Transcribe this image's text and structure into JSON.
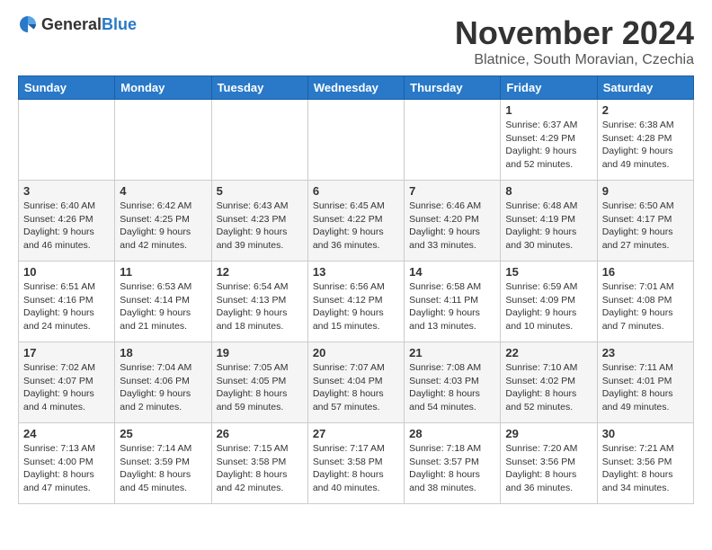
{
  "header": {
    "logo_general": "General",
    "logo_blue": "Blue",
    "month_title": "November 2024",
    "location": "Blatnice, South Moravian, Czechia"
  },
  "days_of_week": [
    "Sunday",
    "Monday",
    "Tuesday",
    "Wednesday",
    "Thursday",
    "Friday",
    "Saturday"
  ],
  "weeks": [
    [
      {
        "day": "",
        "info": ""
      },
      {
        "day": "",
        "info": ""
      },
      {
        "day": "",
        "info": ""
      },
      {
        "day": "",
        "info": ""
      },
      {
        "day": "",
        "info": ""
      },
      {
        "day": "1",
        "info": "Sunrise: 6:37 AM\nSunset: 4:29 PM\nDaylight: 9 hours\nand 52 minutes."
      },
      {
        "day": "2",
        "info": "Sunrise: 6:38 AM\nSunset: 4:28 PM\nDaylight: 9 hours\nand 49 minutes."
      }
    ],
    [
      {
        "day": "3",
        "info": "Sunrise: 6:40 AM\nSunset: 4:26 PM\nDaylight: 9 hours\nand 46 minutes."
      },
      {
        "day": "4",
        "info": "Sunrise: 6:42 AM\nSunset: 4:25 PM\nDaylight: 9 hours\nand 42 minutes."
      },
      {
        "day": "5",
        "info": "Sunrise: 6:43 AM\nSunset: 4:23 PM\nDaylight: 9 hours\nand 39 minutes."
      },
      {
        "day": "6",
        "info": "Sunrise: 6:45 AM\nSunset: 4:22 PM\nDaylight: 9 hours\nand 36 minutes."
      },
      {
        "day": "7",
        "info": "Sunrise: 6:46 AM\nSunset: 4:20 PM\nDaylight: 9 hours\nand 33 minutes."
      },
      {
        "day": "8",
        "info": "Sunrise: 6:48 AM\nSunset: 4:19 PM\nDaylight: 9 hours\nand 30 minutes."
      },
      {
        "day": "9",
        "info": "Sunrise: 6:50 AM\nSunset: 4:17 PM\nDaylight: 9 hours\nand 27 minutes."
      }
    ],
    [
      {
        "day": "10",
        "info": "Sunrise: 6:51 AM\nSunset: 4:16 PM\nDaylight: 9 hours\nand 24 minutes."
      },
      {
        "day": "11",
        "info": "Sunrise: 6:53 AM\nSunset: 4:14 PM\nDaylight: 9 hours\nand 21 minutes."
      },
      {
        "day": "12",
        "info": "Sunrise: 6:54 AM\nSunset: 4:13 PM\nDaylight: 9 hours\nand 18 minutes."
      },
      {
        "day": "13",
        "info": "Sunrise: 6:56 AM\nSunset: 4:12 PM\nDaylight: 9 hours\nand 15 minutes."
      },
      {
        "day": "14",
        "info": "Sunrise: 6:58 AM\nSunset: 4:11 PM\nDaylight: 9 hours\nand 13 minutes."
      },
      {
        "day": "15",
        "info": "Sunrise: 6:59 AM\nSunset: 4:09 PM\nDaylight: 9 hours\nand 10 minutes."
      },
      {
        "day": "16",
        "info": "Sunrise: 7:01 AM\nSunset: 4:08 PM\nDaylight: 9 hours\nand 7 minutes."
      }
    ],
    [
      {
        "day": "17",
        "info": "Sunrise: 7:02 AM\nSunset: 4:07 PM\nDaylight: 9 hours\nand 4 minutes."
      },
      {
        "day": "18",
        "info": "Sunrise: 7:04 AM\nSunset: 4:06 PM\nDaylight: 9 hours\nand 2 minutes."
      },
      {
        "day": "19",
        "info": "Sunrise: 7:05 AM\nSunset: 4:05 PM\nDaylight: 8 hours\nand 59 minutes."
      },
      {
        "day": "20",
        "info": "Sunrise: 7:07 AM\nSunset: 4:04 PM\nDaylight: 8 hours\nand 57 minutes."
      },
      {
        "day": "21",
        "info": "Sunrise: 7:08 AM\nSunset: 4:03 PM\nDaylight: 8 hours\nand 54 minutes."
      },
      {
        "day": "22",
        "info": "Sunrise: 7:10 AM\nSunset: 4:02 PM\nDaylight: 8 hours\nand 52 minutes."
      },
      {
        "day": "23",
        "info": "Sunrise: 7:11 AM\nSunset: 4:01 PM\nDaylight: 8 hours\nand 49 minutes."
      }
    ],
    [
      {
        "day": "24",
        "info": "Sunrise: 7:13 AM\nSunset: 4:00 PM\nDaylight: 8 hours\nand 47 minutes."
      },
      {
        "day": "25",
        "info": "Sunrise: 7:14 AM\nSunset: 3:59 PM\nDaylight: 8 hours\nand 45 minutes."
      },
      {
        "day": "26",
        "info": "Sunrise: 7:15 AM\nSunset: 3:58 PM\nDaylight: 8 hours\nand 42 minutes."
      },
      {
        "day": "27",
        "info": "Sunrise: 7:17 AM\nSunset: 3:58 PM\nDaylight: 8 hours\nand 40 minutes."
      },
      {
        "day": "28",
        "info": "Sunrise: 7:18 AM\nSunset: 3:57 PM\nDaylight: 8 hours\nand 38 minutes."
      },
      {
        "day": "29",
        "info": "Sunrise: 7:20 AM\nSunset: 3:56 PM\nDaylight: 8 hours\nand 36 minutes."
      },
      {
        "day": "30",
        "info": "Sunrise: 7:21 AM\nSunset: 3:56 PM\nDaylight: 8 hours\nand 34 minutes."
      }
    ]
  ]
}
